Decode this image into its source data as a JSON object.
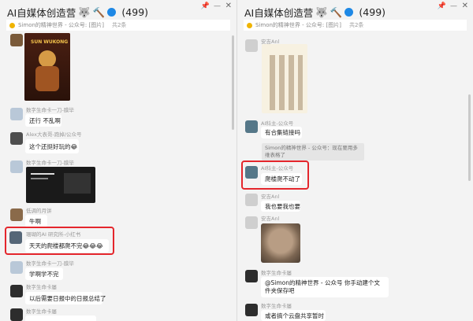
{
  "left": {
    "title": "AI自媒体创造营",
    "count": "(499)",
    "notice": "Simon的精神世界 - 公众号: [图片]",
    "notice_more": "共2条",
    "poster_text": "SUN WUKONG",
    "messages": [
      {
        "nick": "数字生命卡一刀-膜毕",
        "text": "还行 不乱啊"
      },
      {
        "nick": "Alex大表哥-跑掉/公众号",
        "text": "这个还挺好玩的😂"
      },
      {
        "nick": "数字生命卡一刀-膜毕",
        "text": ""
      },
      {
        "nick": "低调的月饼",
        "text": "牛啊"
      },
      {
        "nick": "珊瑚的AI 研究所-小红书",
        "text": "天天的爬楼都爬不完😂😂😂"
      },
      {
        "nick": "数字生命卡一刀-膜毕",
        "text": "学啊学不完"
      },
      {
        "nick": "数字生命卡屡",
        "text": "以后需要日报中的日报总结了"
      },
      {
        "nick": "数字生命卡屡",
        "text": ""
      }
    ]
  },
  "right": {
    "title": "AI自媒体创造营",
    "count": "(499)",
    "notice": "Simon的精神世界 - 公众号: [图片]",
    "notice_more": "共2条",
    "messages": [
      {
        "nick": "安吉Anl",
        "text": ""
      },
      {
        "nick": "AI科主-公众号",
        "text": "有合集链接吗"
      },
      {
        "nick": "AI科主-公众号",
        "text": "爬楼爬不动了"
      },
      {
        "nick": "安吉Anl",
        "text": "我也要我也要"
      },
      {
        "nick": "安吉Anl",
        "text": ""
      },
      {
        "nick": "数字生命卡屡",
        "text": "@Simon的精神世界 - 公众号 你手动建个文件夹保存吧"
      },
      {
        "nick": "数字生命卡屡",
        "text": "或者搞个云盘共享暂时"
      }
    ],
    "system": "Simon的精神世界 - 公众号：现在要用多维表格了"
  }
}
